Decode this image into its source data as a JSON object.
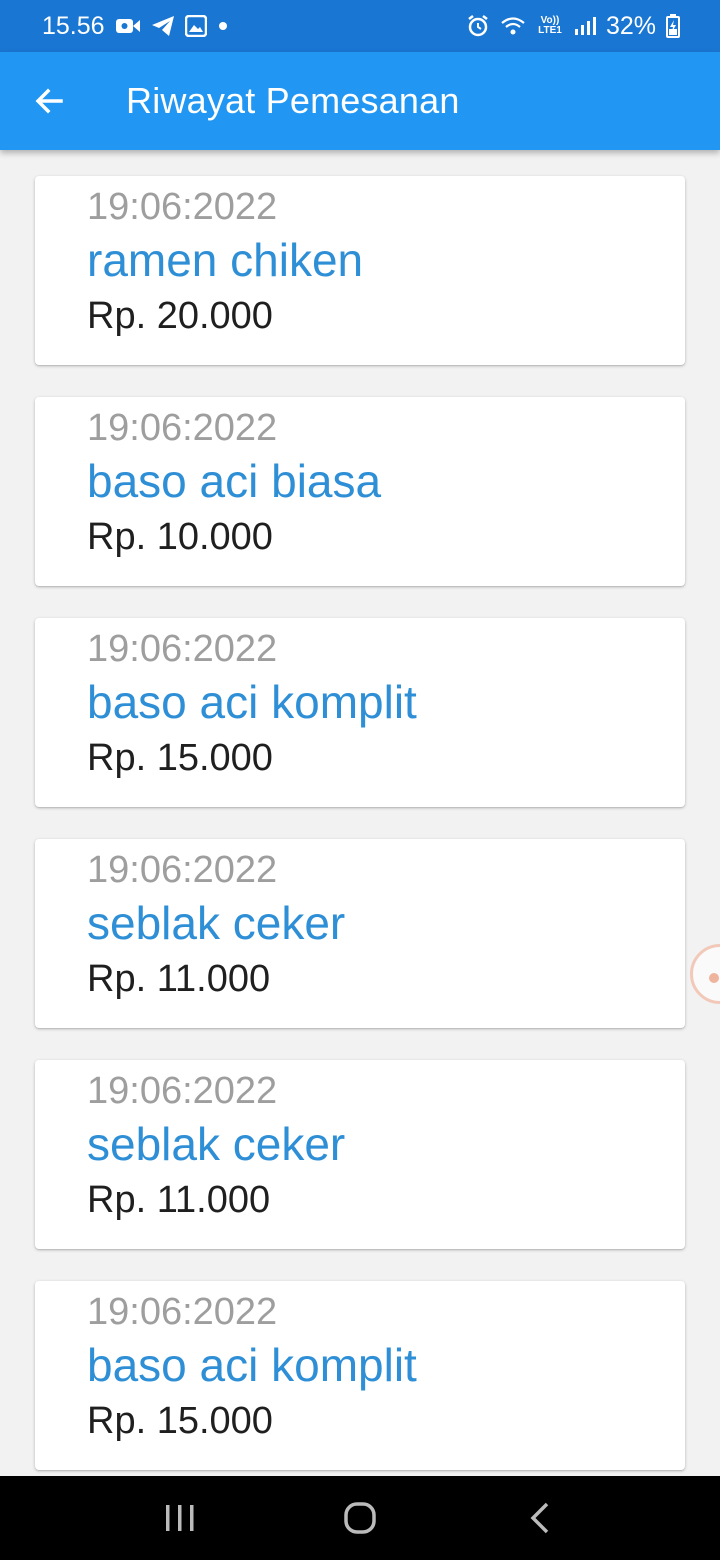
{
  "status_bar": {
    "time": "15.56",
    "battery": "32%",
    "icons": [
      "video-icon",
      "telegram-icon",
      "gallery-icon",
      "dot-icon",
      "alarm-icon",
      "wifi-icon",
      "volte-icon",
      "signal-icon",
      "battery-icon"
    ],
    "volte_text": "Vo)) LTE1"
  },
  "app_bar": {
    "title": "Riwayat Pemesanan",
    "back_icon": "arrow-back-icon",
    "background": "#2196f3"
  },
  "orders": [
    {
      "date": "19:06:2022",
      "name": "ramen chiken",
      "price": "Rp. 20.000"
    },
    {
      "date": "19:06:2022",
      "name": "baso aci biasa",
      "price": "Rp. 10.000"
    },
    {
      "date": "19:06:2022",
      "name": "baso aci komplit",
      "price": "Rp. 15.000"
    },
    {
      "date": "19:06:2022",
      "name": "seblak ceker",
      "price": "Rp. 11.000"
    },
    {
      "date": "19:06:2022",
      "name": "seblak ceker",
      "price": "Rp. 11.000"
    },
    {
      "date": "19:06:2022",
      "name": "baso aci komplit",
      "price": "Rp. 15.000"
    }
  ],
  "colors": {
    "status_bar": "#1976d2",
    "accent": "#2196f3",
    "item_name": "#2e8fd6",
    "date_text": "#9e9e9e"
  },
  "nav_bar": {
    "icons": [
      "recent-apps-icon",
      "home-icon",
      "back-icon"
    ]
  }
}
